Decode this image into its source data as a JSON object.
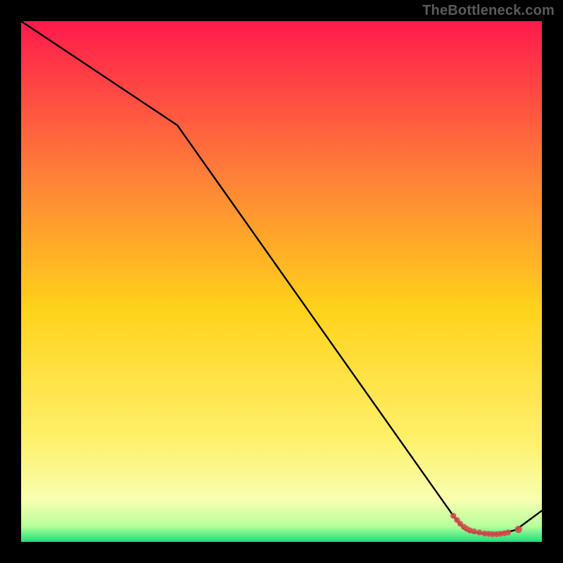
{
  "watermark": "TheBottleneck.com",
  "chart_data": {
    "type": "line",
    "title": "",
    "xlabel": "",
    "ylabel": "",
    "xlim": [
      0,
      100
    ],
    "ylim": [
      0,
      100
    ],
    "series": [
      {
        "name": "curve",
        "x": [
          0,
          30,
          83,
          85,
          86,
          87,
          89,
          90,
          91,
          92,
          93,
          95,
          100
        ],
        "y": [
          100,
          80,
          5,
          2.5,
          2,
          1.8,
          1.6,
          1.5,
          1.5,
          1.6,
          1.8,
          2.3,
          6
        ]
      }
    ],
    "markers": [
      {
        "x": 83.0,
        "y": 5.0
      },
      {
        "x": 83.7,
        "y": 4.2
      },
      {
        "x": 84.3,
        "y": 3.5
      },
      {
        "x": 85.0,
        "y": 2.9
      },
      {
        "x": 85.6,
        "y": 2.5
      },
      {
        "x": 86.2,
        "y": 2.2
      },
      {
        "x": 87.0,
        "y": 2.0
      },
      {
        "x": 88.0,
        "y": 1.8
      },
      {
        "x": 89.0,
        "y": 1.6
      },
      {
        "x": 89.8,
        "y": 1.55
      },
      {
        "x": 90.5,
        "y": 1.5
      },
      {
        "x": 91.3,
        "y": 1.5
      },
      {
        "x": 92.0,
        "y": 1.55
      },
      {
        "x": 92.8,
        "y": 1.65
      },
      {
        "x": 93.5,
        "y": 1.8
      },
      {
        "x": 95.5,
        "y": 2.4
      }
    ],
    "colors": {
      "line": "#000000",
      "marker": "#d54a4d",
      "gradient_top": "#ff1a4b",
      "gradient_mid_upper": "#ff7a3a",
      "gradient_mid": "#ffd21a",
      "gradient_lower": "#fff06a",
      "gradient_band": "#f7ffb0",
      "gradient_bottom": "#19e07a"
    }
  }
}
